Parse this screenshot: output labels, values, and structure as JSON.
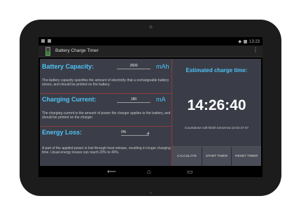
{
  "status": {
    "time": "13:23"
  },
  "app": {
    "title": "Battery Charge Timer",
    "overflow": "⋮"
  },
  "capacity": {
    "title": "Battery Capacity:",
    "value": "2600",
    "unit": "mAh",
    "description": "The battery capacity specifies the amount of electricity that a rechargeable battery stores, and should be printed on the battery."
  },
  "current": {
    "title": "Charging Current:",
    "value": "180",
    "unit": "mA",
    "description": "The charging current is the amount of power the charger applies to the battery, and should be printed on the charger."
  },
  "loss": {
    "title": "Energy Loss:",
    "value": "0%",
    "description": "A part of the applied power is lost through heat release, resulting in longer charging time. Usual energy losses can reach 20% to 40%."
  },
  "result": {
    "title": "Estimated charge time:",
    "timer": "14:26:40",
    "countdown": "Countdown will finish tomorrow at 03:47:07"
  },
  "buttons": {
    "calculate": "CALCULATE",
    "start": "START TIMER",
    "reset": "RESET TIMER"
  },
  "nav": {
    "back": "⟵",
    "home": "⌂",
    "recents": "▭"
  }
}
